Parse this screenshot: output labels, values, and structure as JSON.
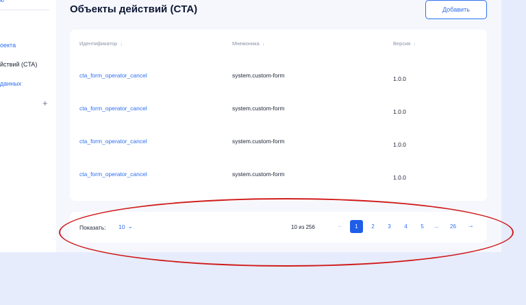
{
  "sidebar": {
    "top_link": "ю",
    "items": [
      {
        "label": "оекта"
      },
      {
        "label": "йствий (CTA)"
      },
      {
        "label": "данных"
      }
    ],
    "plus_icon": "+"
  },
  "header": {
    "title": "Объекты действий (CTA)",
    "add_label": "Добавить"
  },
  "table": {
    "columns": [
      {
        "label": "Идентификатор",
        "sort_icon": "↓"
      },
      {
        "label": "Мнемоника",
        "sort_icon": "↓"
      },
      {
        "label": "Версия",
        "sort_icon": "↓"
      }
    ],
    "rows": [
      {
        "id": "cta_form_operator_cancel",
        "mnemonic": "system.custom-form",
        "version": "1.0.0"
      },
      {
        "id": "cta_form_operator_cancel",
        "mnemonic": "system.custom-form",
        "version": "1.0.0"
      },
      {
        "id": "cta_form_operator_cancel",
        "mnemonic": "system.custom-form",
        "version": "1.0.0"
      },
      {
        "id": "cta_form_operator_cancel",
        "mnemonic": "system.custom-form",
        "version": "1.0.0"
      }
    ]
  },
  "pagination": {
    "show_label": "Показать:",
    "page_size": "10",
    "range_text": "10 из 256",
    "prev_icon": "←",
    "next_icon": "→",
    "pages": [
      "1",
      "2",
      "3",
      "4",
      "5"
    ],
    "ellipsis": "...",
    "last_page": "26",
    "current_page": "1"
  },
  "colors": {
    "accent": "#2d6ef0",
    "active_page": "#1f5ee8",
    "annotation": "#d01a1a",
    "background": "#e6ecfb"
  }
}
